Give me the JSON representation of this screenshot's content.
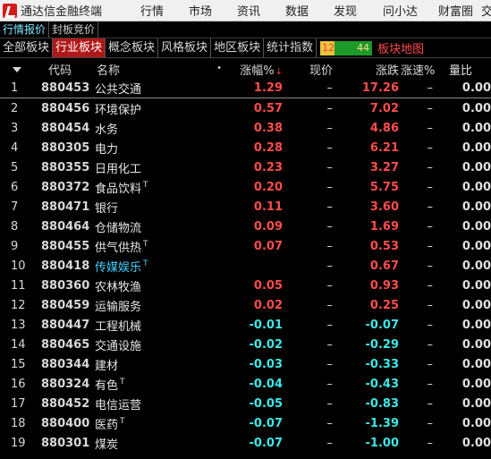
{
  "app": {
    "title": "通达信金融终端"
  },
  "menu": [
    "行情",
    "市场",
    "资讯",
    "数据",
    "发现",
    "问小达",
    "财富圈",
    "交"
  ],
  "subtabs": [
    "行情报价",
    "封板竞价"
  ],
  "board_tabs": [
    "全部板块",
    "行业板块",
    "概念板块",
    "风格板块",
    "地区板块",
    "统计指数"
  ],
  "ratio": {
    "up": "12",
    "down": "44"
  },
  "board_map": "板块地图",
  "columns": {
    "code": "代码",
    "name": "名称",
    "pct": "涨幅%",
    "price": "现价",
    "chg": "涨跌",
    "speed": "涨速%",
    "vol": "量比"
  },
  "rows": [
    {
      "idx": "1",
      "code": "880453",
      "name": "公共交通",
      "t": "",
      "pct": "1.29",
      "price": "–",
      "chg": "17.26",
      "speed": "–",
      "vol": "0.00",
      "dir": "up"
    },
    {
      "idx": "2",
      "code": "880456",
      "name": "环境保护",
      "t": "",
      "pct": "0.57",
      "price": "–",
      "chg": "7.02",
      "speed": "–",
      "vol": "0.00",
      "dir": "up"
    },
    {
      "idx": "3",
      "code": "880454",
      "name": "水务",
      "t": "",
      "pct": "0.38",
      "price": "–",
      "chg": "4.86",
      "speed": "–",
      "vol": "0.00",
      "dir": "up"
    },
    {
      "idx": "4",
      "code": "880305",
      "name": "电力",
      "t": "",
      "pct": "0.28",
      "price": "–",
      "chg": "6.21",
      "speed": "–",
      "vol": "0.00",
      "dir": "up"
    },
    {
      "idx": "5",
      "code": "880355",
      "name": "日用化工",
      "t": "",
      "pct": "0.23",
      "price": "–",
      "chg": "3.27",
      "speed": "–",
      "vol": "0.00",
      "dir": "up"
    },
    {
      "idx": "6",
      "code": "880372",
      "name": "食品饮料",
      "t": "T",
      "pct": "0.20",
      "price": "–",
      "chg": "5.75",
      "speed": "–",
      "vol": "0.00",
      "dir": "up"
    },
    {
      "idx": "7",
      "code": "880471",
      "name": "银行",
      "t": "",
      "pct": "0.11",
      "price": "–",
      "chg": "3.60",
      "speed": "–",
      "vol": "0.00",
      "dir": "up"
    },
    {
      "idx": "8",
      "code": "880464",
      "name": "仓储物流",
      "t": "",
      "pct": "0.09",
      "price": "–",
      "chg": "1.69",
      "speed": "–",
      "vol": "0.00",
      "dir": "up"
    },
    {
      "idx": "9",
      "code": "880455",
      "name": "供气供热",
      "t": "T",
      "pct": "0.07",
      "price": "–",
      "chg": "0.53",
      "speed": "–",
      "vol": "0.00",
      "dir": "up"
    },
    {
      "idx": "10",
      "code": "880418",
      "name": "传媒娱乐",
      "t": "T",
      "pct": "",
      "price": "–",
      "chg": "0.67",
      "speed": "–",
      "vol": "0.00",
      "dir": "up",
      "hl": true
    },
    {
      "idx": "11",
      "code": "880360",
      "name": "农林牧渔",
      "t": "",
      "pct": "0.05",
      "price": "–",
      "chg": "0.93",
      "speed": "–",
      "vol": "0.00",
      "dir": "up"
    },
    {
      "idx": "12",
      "code": "880459",
      "name": "运输服务",
      "t": "",
      "pct": "0.02",
      "price": "–",
      "chg": "0.25",
      "speed": "–",
      "vol": "0.00",
      "dir": "up"
    },
    {
      "idx": "13",
      "code": "880447",
      "name": "工程机械",
      "t": "",
      "pct": "-0.01",
      "price": "–",
      "chg": "-0.07",
      "speed": "–",
      "vol": "0.00",
      "dir": "dn"
    },
    {
      "idx": "14",
      "code": "880465",
      "name": "交通设施",
      "t": "",
      "pct": "-0.02",
      "price": "–",
      "chg": "-0.29",
      "speed": "–",
      "vol": "0.00",
      "dir": "dn"
    },
    {
      "idx": "15",
      "code": "880344",
      "name": "建材",
      "t": "",
      "pct": "-0.03",
      "price": "–",
      "chg": "-0.33",
      "speed": "–",
      "vol": "0.00",
      "dir": "dn"
    },
    {
      "idx": "16",
      "code": "880324",
      "name": "有色",
      "t": "T",
      "pct": "-0.04",
      "price": "–",
      "chg": "-0.43",
      "speed": "–",
      "vol": "0.00",
      "dir": "dn"
    },
    {
      "idx": "17",
      "code": "880452",
      "name": "电信运营",
      "t": "",
      "pct": "-0.05",
      "price": "–",
      "chg": "-0.83",
      "speed": "–",
      "vol": "0.00",
      "dir": "dn"
    },
    {
      "idx": "18",
      "code": "880400",
      "name": "医药",
      "t": "T",
      "pct": "-0.07",
      "price": "–",
      "chg": "-1.39",
      "speed": "–",
      "vol": "0.00",
      "dir": "dn"
    },
    {
      "idx": "19",
      "code": "880301",
      "name": "煤炭",
      "t": "",
      "pct": "-0.07",
      "price": "–",
      "chg": "-1.00",
      "speed": "–",
      "vol": "0.00",
      "dir": "dn"
    }
  ]
}
